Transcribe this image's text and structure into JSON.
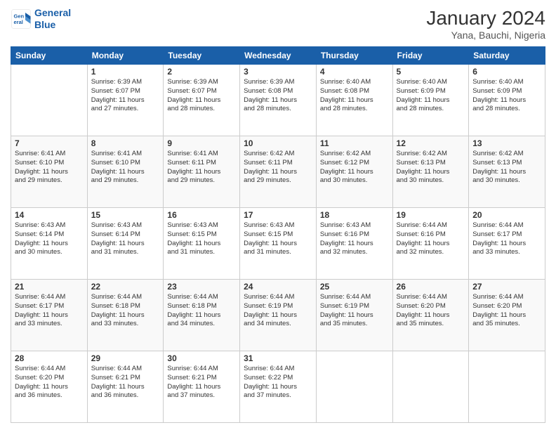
{
  "header": {
    "logo_line1": "General",
    "logo_line2": "Blue",
    "title": "January 2024",
    "subtitle": "Yana, Bauchi, Nigeria"
  },
  "days_of_week": [
    "Sunday",
    "Monday",
    "Tuesday",
    "Wednesday",
    "Thursday",
    "Friday",
    "Saturday"
  ],
  "weeks": [
    {
      "days": [
        {
          "num": "",
          "info": ""
        },
        {
          "num": "1",
          "info": "Sunrise: 6:39 AM\nSunset: 6:07 PM\nDaylight: 11 hours\nand 27 minutes."
        },
        {
          "num": "2",
          "info": "Sunrise: 6:39 AM\nSunset: 6:07 PM\nDaylight: 11 hours\nand 28 minutes."
        },
        {
          "num": "3",
          "info": "Sunrise: 6:39 AM\nSunset: 6:08 PM\nDaylight: 11 hours\nand 28 minutes."
        },
        {
          "num": "4",
          "info": "Sunrise: 6:40 AM\nSunset: 6:08 PM\nDaylight: 11 hours\nand 28 minutes."
        },
        {
          "num": "5",
          "info": "Sunrise: 6:40 AM\nSunset: 6:09 PM\nDaylight: 11 hours\nand 28 minutes."
        },
        {
          "num": "6",
          "info": "Sunrise: 6:40 AM\nSunset: 6:09 PM\nDaylight: 11 hours\nand 28 minutes."
        }
      ]
    },
    {
      "days": [
        {
          "num": "7",
          "info": "Sunrise: 6:41 AM\nSunset: 6:10 PM\nDaylight: 11 hours\nand 29 minutes."
        },
        {
          "num": "8",
          "info": "Sunrise: 6:41 AM\nSunset: 6:10 PM\nDaylight: 11 hours\nand 29 minutes."
        },
        {
          "num": "9",
          "info": "Sunrise: 6:41 AM\nSunset: 6:11 PM\nDaylight: 11 hours\nand 29 minutes."
        },
        {
          "num": "10",
          "info": "Sunrise: 6:42 AM\nSunset: 6:11 PM\nDaylight: 11 hours\nand 29 minutes."
        },
        {
          "num": "11",
          "info": "Sunrise: 6:42 AM\nSunset: 6:12 PM\nDaylight: 11 hours\nand 30 minutes."
        },
        {
          "num": "12",
          "info": "Sunrise: 6:42 AM\nSunset: 6:13 PM\nDaylight: 11 hours\nand 30 minutes."
        },
        {
          "num": "13",
          "info": "Sunrise: 6:42 AM\nSunset: 6:13 PM\nDaylight: 11 hours\nand 30 minutes."
        }
      ]
    },
    {
      "days": [
        {
          "num": "14",
          "info": "Sunrise: 6:43 AM\nSunset: 6:14 PM\nDaylight: 11 hours\nand 30 minutes."
        },
        {
          "num": "15",
          "info": "Sunrise: 6:43 AM\nSunset: 6:14 PM\nDaylight: 11 hours\nand 31 minutes."
        },
        {
          "num": "16",
          "info": "Sunrise: 6:43 AM\nSunset: 6:15 PM\nDaylight: 11 hours\nand 31 minutes."
        },
        {
          "num": "17",
          "info": "Sunrise: 6:43 AM\nSunset: 6:15 PM\nDaylight: 11 hours\nand 31 minutes."
        },
        {
          "num": "18",
          "info": "Sunrise: 6:43 AM\nSunset: 6:16 PM\nDaylight: 11 hours\nand 32 minutes."
        },
        {
          "num": "19",
          "info": "Sunrise: 6:44 AM\nSunset: 6:16 PM\nDaylight: 11 hours\nand 32 minutes."
        },
        {
          "num": "20",
          "info": "Sunrise: 6:44 AM\nSunset: 6:17 PM\nDaylight: 11 hours\nand 33 minutes."
        }
      ]
    },
    {
      "days": [
        {
          "num": "21",
          "info": "Sunrise: 6:44 AM\nSunset: 6:17 PM\nDaylight: 11 hours\nand 33 minutes."
        },
        {
          "num": "22",
          "info": "Sunrise: 6:44 AM\nSunset: 6:18 PM\nDaylight: 11 hours\nand 33 minutes."
        },
        {
          "num": "23",
          "info": "Sunrise: 6:44 AM\nSunset: 6:18 PM\nDaylight: 11 hours\nand 34 minutes."
        },
        {
          "num": "24",
          "info": "Sunrise: 6:44 AM\nSunset: 6:19 PM\nDaylight: 11 hours\nand 34 minutes."
        },
        {
          "num": "25",
          "info": "Sunrise: 6:44 AM\nSunset: 6:19 PM\nDaylight: 11 hours\nand 35 minutes."
        },
        {
          "num": "26",
          "info": "Sunrise: 6:44 AM\nSunset: 6:20 PM\nDaylight: 11 hours\nand 35 minutes."
        },
        {
          "num": "27",
          "info": "Sunrise: 6:44 AM\nSunset: 6:20 PM\nDaylight: 11 hours\nand 35 minutes."
        }
      ]
    },
    {
      "days": [
        {
          "num": "28",
          "info": "Sunrise: 6:44 AM\nSunset: 6:20 PM\nDaylight: 11 hours\nand 36 minutes."
        },
        {
          "num": "29",
          "info": "Sunrise: 6:44 AM\nSunset: 6:21 PM\nDaylight: 11 hours\nand 36 minutes."
        },
        {
          "num": "30",
          "info": "Sunrise: 6:44 AM\nSunset: 6:21 PM\nDaylight: 11 hours\nand 37 minutes."
        },
        {
          "num": "31",
          "info": "Sunrise: 6:44 AM\nSunset: 6:22 PM\nDaylight: 11 hours\nand 37 minutes."
        },
        {
          "num": "",
          "info": ""
        },
        {
          "num": "",
          "info": ""
        },
        {
          "num": "",
          "info": ""
        }
      ]
    }
  ]
}
